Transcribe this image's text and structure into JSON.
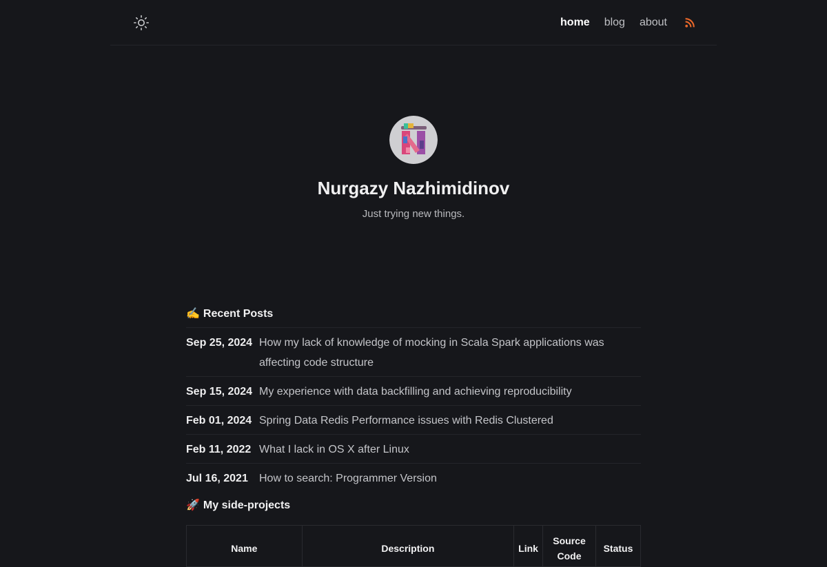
{
  "header": {
    "theme_toggle_icon": "sun-icon",
    "nav": {
      "home": "home",
      "blog": "blog",
      "about": "about"
    },
    "rss_icon": "rss-icon",
    "rss_color": "#e8672a"
  },
  "profile": {
    "name": "Nurgazy Nazhimidinov",
    "subtitle": "Just trying new things."
  },
  "recent_posts": {
    "emoji": "✍️",
    "title": "Recent Posts",
    "items": [
      {
        "date": "Sep 25, 2024",
        "title": "How my lack of knowledge of mocking in Scala Spark applications was affecting code structure"
      },
      {
        "date": "Sep 15, 2024",
        "title": "My experience with data backfilling and achieving reproducibility"
      },
      {
        "date": "Feb 01, 2024",
        "title": "Spring Data Redis Performance issues with Redis Clustered"
      },
      {
        "date": "Feb 11, 2022",
        "title": "What I lack in OS X after Linux"
      },
      {
        "date": "Jul 16, 2021",
        "title": "How to search: Programmer Version"
      }
    ]
  },
  "side_projects": {
    "emoji": "🚀",
    "title": "My side-projects",
    "columns": [
      "Name",
      "Description",
      "Link",
      "Source Code",
      "Status"
    ]
  }
}
